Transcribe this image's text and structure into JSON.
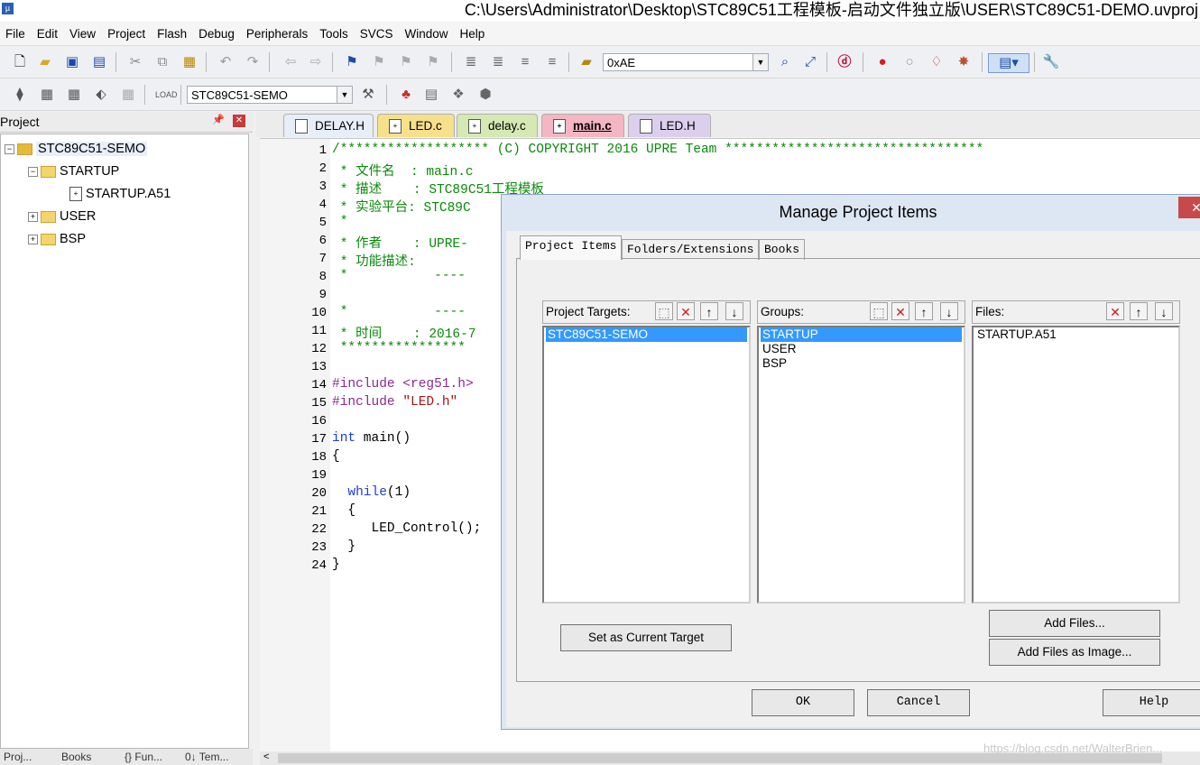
{
  "window": {
    "title": "C:\\Users\\Administrator\\Desktop\\STC89C51工程模板-启动文件独立版\\USER\\STC89C51-DEMO.uvproj"
  },
  "menu": [
    "File",
    "Edit",
    "View",
    "Project",
    "Flash",
    "Debug",
    "Peripherals",
    "Tools",
    "SVCS",
    "Window",
    "Help"
  ],
  "toolbar": {
    "find_value": "0xAE",
    "target_value": "STC89C51-SEMO"
  },
  "project": {
    "title": "Project",
    "root": "STC89C51-SEMO",
    "groups": {
      "startup": "STARTUP",
      "startup_file": "STARTUP.A51",
      "user": "USER",
      "bsp": "BSP"
    },
    "bottom_tabs": [
      "Proj...",
      "Books",
      "{} Fun...",
      "0↓ Tem..."
    ]
  },
  "editor": {
    "tabs": [
      "DELAY.H",
      "LED.c",
      "delay.c",
      "main.c",
      "LED.H"
    ],
    "line_numbers": [
      "1",
      "2",
      "3",
      "4",
      "5",
      "6",
      "7",
      "8",
      "9",
      "10",
      "11",
      "12",
      "13",
      "14",
      "15",
      "16",
      "17",
      "18",
      "19",
      "20",
      "21",
      "22",
      "23",
      "24"
    ],
    "code": {
      "l1": "/******************* (C) COPYRIGHT 2016 UPRE Team *********************************",
      "l2": " * 文件名  : main.c",
      "l3": " * 描述    : STC89C51工程模板",
      "l4": " * 实验平台: STC89C",
      "l5": " *",
      "l6": " * 作者    : UPRE-",
      "l7": " * 功能描述:",
      "l8": " *           ----",
      "l9": "",
      "l10": " *           ----",
      "l11": " * 时间    : 2016-7",
      "l12": " ****************",
      "l13": "",
      "l14_a": "#include ",
      "l14_b": "<reg51.h>",
      "l15_a": "#include ",
      "l15_b": "\"LED.h\"",
      "l16": "",
      "l17_a": "int",
      "l17_b": " main()",
      "l18": "{",
      "l19": "",
      "l20_a": "  while",
      "l20_b": "(1)",
      "l21": "  {",
      "l22": "     LED_Control();",
      "l23": "  }",
      "l24": "}"
    }
  },
  "dialog": {
    "title": "Manage Project Items",
    "tabs": [
      "Project Items",
      "Folders/Extensions",
      "Books"
    ],
    "targets_label": "Project Targets:",
    "targets": [
      "STC89C51-SEMO"
    ],
    "groups_label": "Groups:",
    "groups": [
      "STARTUP",
      "USER",
      "BSP"
    ],
    "files_label": "Files:",
    "files": [
      "STARTUP.A51"
    ],
    "set_target_button": "Set as Current Target",
    "add_files_button": "Add Files...",
    "add_image_button": "Add Files as Image...",
    "ok_button": "OK",
    "cancel_button": "Cancel",
    "help_button": "Help"
  },
  "watermark": "https://blog.csdn.net/WalterBrien..."
}
